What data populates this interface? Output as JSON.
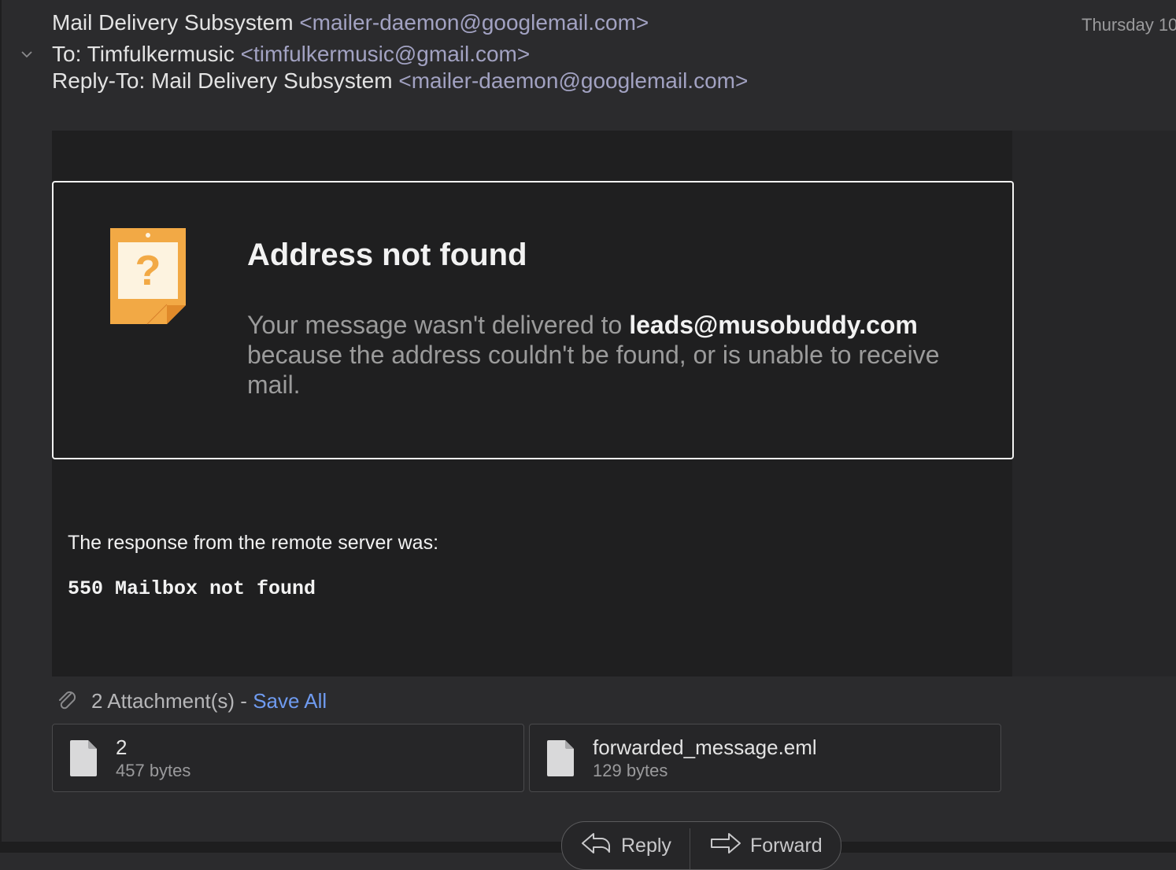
{
  "header": {
    "sender_name": "Mail Delivery Subsystem",
    "sender_address": "<mailer-daemon@googlemail.com>",
    "to_prefix": "To: ",
    "to_name": "Timfulkermusic",
    "to_address": "<timfulkermusic@gmail.com>",
    "replyto_prefix": "Reply-To: ",
    "replyto_name": "Mail Delivery Subsystem",
    "replyto_address": "<mailer-daemon@googlemail.com>",
    "date": "Thursday 10"
  },
  "card": {
    "icon": "question-note-icon",
    "title": "Address not found",
    "text_before": "Your message wasn't delivered to ",
    "recipient": "leads@musobuddy.com",
    "text_after": " because the address couldn't be found, or is unable to receive mail."
  },
  "response": {
    "label": "The response from the remote server was:",
    "code": "550 Mailbox not found"
  },
  "attachments": {
    "header": "2 Attachment(s) - ",
    "save_all": "Save All",
    "items": [
      {
        "name": "2",
        "size": "457 bytes",
        "icon": "file-icon"
      },
      {
        "name": "forwarded_message.eml",
        "size": "129 bytes",
        "icon": "file-icon"
      }
    ]
  },
  "actions": {
    "reply": "Reply",
    "forward": "Forward"
  },
  "colors": {
    "background": "#2b2b2d",
    "panel": "#1f1f20",
    "link": "#6f9bf0",
    "address": "#a2a2c2",
    "icon_orange": "#f2a945"
  }
}
